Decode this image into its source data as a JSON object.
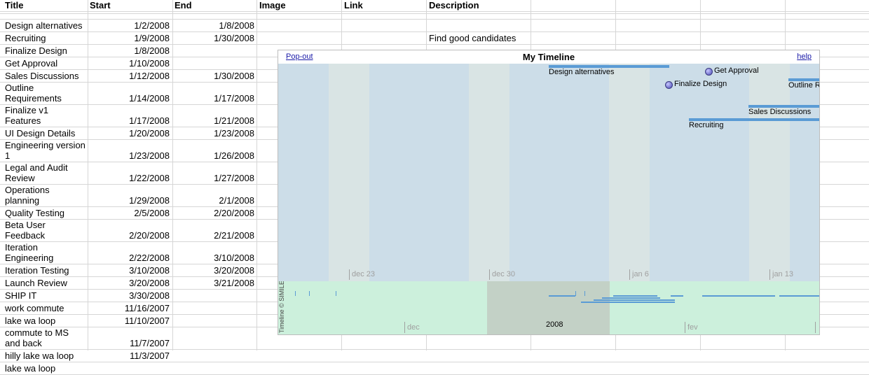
{
  "headers": [
    "Title",
    "Start",
    "End",
    "Image",
    "Link",
    "Description"
  ],
  "rows": [
    {
      "title": [
        "Design alternatives"
      ],
      "start": "1/2/2008",
      "end": "1/8/2008",
      "description": ""
    },
    {
      "title": [
        "Recruiting"
      ],
      "start": "1/9/2008",
      "end": "1/30/2008",
      "description": "Find good candidates"
    },
    {
      "title": [
        "Finalize Design"
      ],
      "start": "1/8/2008",
      "end": "",
      "description": ""
    },
    {
      "title": [
        "Get Approval"
      ],
      "start": "1/10/2008",
      "end": "",
      "description": ""
    },
    {
      "title": [
        "Sales Discussions"
      ],
      "start": "1/12/2008",
      "end": "1/30/2008",
      "description": ""
    },
    {
      "title": [
        "Outline",
        "Requirements"
      ],
      "start": "1/14/2008",
      "end": "1/17/2008",
      "description": ""
    },
    {
      "title": [
        "Finalize v1",
        "Features"
      ],
      "start": "1/17/2008",
      "end": "1/21/2008",
      "description": ""
    },
    {
      "title": [
        "UI Design Details"
      ],
      "start": "1/20/2008",
      "end": "1/23/2008",
      "description": ""
    },
    {
      "title": [
        "Engineering version",
        "1"
      ],
      "start": "1/23/2008",
      "end": "1/26/2008",
      "description": ""
    },
    {
      "title": [
        "Legal and Audit",
        "Review"
      ],
      "start": "1/22/2008",
      "end": "1/27/2008",
      "description": ""
    },
    {
      "title": [
        "Operations",
        "planning"
      ],
      "start": "1/29/2008",
      "end": "2/1/2008",
      "description": ""
    },
    {
      "title": [
        "Quality Testing"
      ],
      "start": "2/5/2008",
      "end": "2/20/2008",
      "description": ""
    },
    {
      "title": [
        "Beta User",
        "Feedback"
      ],
      "start": "2/20/2008",
      "end": "2/21/2008",
      "description": ""
    },
    {
      "title": [
        "Iteration",
        "Engineering"
      ],
      "start": "2/22/2008",
      "end": "3/10/2008",
      "description": ""
    },
    {
      "title": [
        "Iteration Testing"
      ],
      "start": "3/10/2008",
      "end": "3/20/2008",
      "description": ""
    },
    {
      "title": [
        "Launch Review"
      ],
      "start": "3/20/2008",
      "end": "3/21/2008",
      "description": ""
    },
    {
      "title": [
        "SHIP IT"
      ],
      "start": "3/30/2008",
      "end": "",
      "description": ""
    },
    {
      "title": [
        "work commute"
      ],
      "start": "11/16/2007",
      "end": "",
      "description": ""
    },
    {
      "title": [
        "lake wa loop"
      ],
      "start": "11/10/2007",
      "end": "",
      "description": ""
    },
    {
      "title": [
        "commute to MS",
        "and back"
      ],
      "start": "11/7/2007",
      "end": "",
      "description": ""
    },
    {
      "title": [
        "hilly lake wa loop"
      ],
      "start": "11/3/2007",
      "end": "",
      "description": ""
    },
    {
      "title": [
        "lake wa loop"
      ],
      "start": "",
      "end": "",
      "description": ""
    }
  ],
  "timeline": {
    "title": "My Timeline",
    "popout_label": "Pop-out",
    "help_label": "help",
    "credit": "Timeline © SIMILE",
    "detail_ticks": [
      "dec 23",
      "dec 30",
      "jan 6",
      "jan 13"
    ],
    "overview_ticks": [
      "dec",
      "fev"
    ],
    "overview_year": "2008",
    "events": [
      {
        "label": "Design alternatives",
        "kind": "duration"
      },
      {
        "label": "Get Approval",
        "kind": "instant"
      },
      {
        "label": "Finalize Design",
        "kind": "instant"
      },
      {
        "label": "Outline R",
        "kind": "duration"
      },
      {
        "label": "Sales Discussions",
        "kind": "duration"
      },
      {
        "label": "Recruiting",
        "kind": "duration"
      }
    ]
  }
}
